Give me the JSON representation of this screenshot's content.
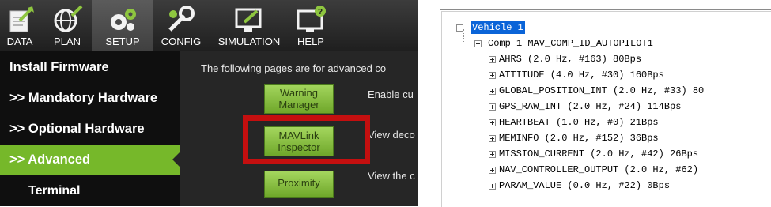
{
  "toolbar": {
    "items": [
      {
        "label": "DATA",
        "icon": "data-icon"
      },
      {
        "label": "PLAN",
        "icon": "globe-icon"
      },
      {
        "label": "SETUP",
        "icon": "gears-icon"
      },
      {
        "label": "CONFIG",
        "icon": "wrench-icon"
      },
      {
        "label": "SIMULATION",
        "icon": "monitor-icon"
      },
      {
        "label": "HELP",
        "icon": "help-monitor-icon"
      }
    ],
    "active": "SETUP"
  },
  "sidebar": {
    "items": [
      {
        "label": "Install Firmware"
      },
      {
        "label": ">> Mandatory Hardware"
      },
      {
        "label": ">> Optional Hardware"
      },
      {
        "label": ">> Advanced"
      },
      {
        "label": "Terminal"
      }
    ],
    "active": ">> Advanced"
  },
  "content": {
    "intro": "The following pages are for advanced co",
    "buttons": [
      {
        "label_line1": "Warning",
        "label_line2": "Manager",
        "desc": "Enable cu"
      },
      {
        "label_line1": "MAVLink",
        "label_line2": "Inspector",
        "desc": "View deco"
      },
      {
        "label_line1": "Proximity",
        "label_line2": "",
        "desc": "View the c"
      }
    ]
  },
  "colors": {
    "accent_green": "#76b82a",
    "highlight_red": "#c40f0f",
    "tree_selection": "#0a64d8"
  },
  "tree": {
    "root": "Vehicle 1",
    "component": "Comp 1 MAV_COMP_ID_AUTOPILOT1",
    "messages": [
      "AHRS (2.0 Hz, #163) 80Bps",
      "ATTITUDE (4.0 Hz, #30) 160Bps",
      "GLOBAL_POSITION_INT (2.0 Hz, #33) 80",
      "GPS_RAW_INT (2.0 Hz, #24) 114Bps",
      "HEARTBEAT (1.0 Hz, #0) 21Bps",
      "MEMINFO (2.0 Hz, #152) 36Bps",
      "MISSION_CURRENT (2.0 Hz, #42) 26Bps",
      "NAV_CONTROLLER_OUTPUT (2.0 Hz, #62)",
      "PARAM_VALUE (0.0 Hz, #22) 0Bps"
    ]
  }
}
